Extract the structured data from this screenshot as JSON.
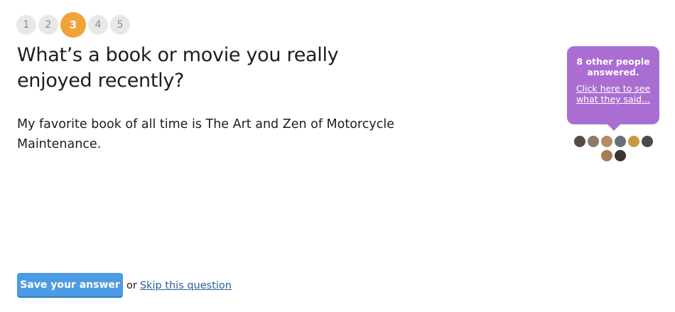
{
  "steps": [
    {
      "label": "1",
      "active": false
    },
    {
      "label": "2",
      "active": false
    },
    {
      "label": "3",
      "active": true
    },
    {
      "label": "4",
      "active": false
    },
    {
      "label": "5",
      "active": false
    }
  ],
  "question": "What’s a book or movie you really enjoyed recently?",
  "answer": "My favorite book of all time is The Art and Zen of Motorcycle Maintenance.",
  "others_bubble": {
    "title": "8 other people answered.",
    "link": "Click here to see what they said..."
  },
  "avatars": [
    {
      "color": "#5a4a44"
    },
    {
      "color": "#8c7a62"
    },
    {
      "color": "#b58a66"
    },
    {
      "color": "#6b6f78"
    },
    {
      "color": "#c99a3e"
    },
    {
      "color": "#4a4a4a"
    },
    {
      "color": "#a87c52"
    },
    {
      "color": "#3e3430"
    }
  ],
  "actions": {
    "save_label": "Save your answer",
    "or_text": "or",
    "skip_label": "Skip this question"
  },
  "colors": {
    "active_step": "#f0a33a",
    "bubble": "#aa6dd1",
    "save_button": "#4c9be3",
    "link": "#2e5e9e"
  }
}
